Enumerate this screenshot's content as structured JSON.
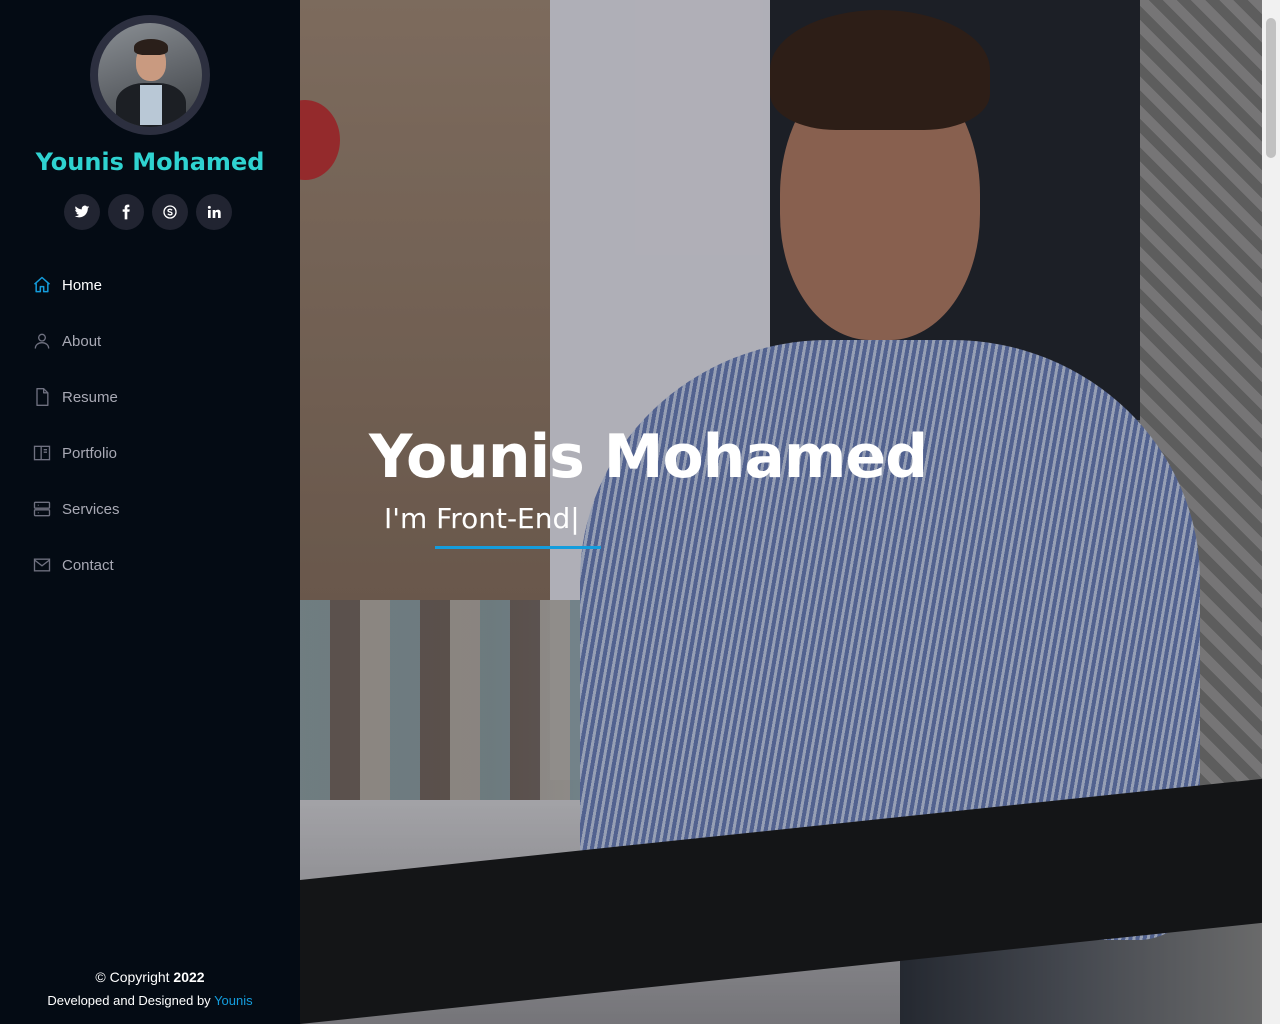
{
  "sidebar": {
    "name": "Younis Mohamed",
    "socials": [
      {
        "icon": "twitter-icon",
        "label": "twitter"
      },
      {
        "icon": "facebook-icon",
        "label": "facebook"
      },
      {
        "icon": "skype-icon",
        "label": "skype"
      },
      {
        "icon": "linkedin-icon",
        "label": "linkedin"
      }
    ],
    "nav": [
      {
        "label": "Home",
        "icon": "home-icon",
        "active": true
      },
      {
        "label": "About",
        "icon": "user-icon"
      },
      {
        "label": "Resume",
        "icon": "file-icon"
      },
      {
        "label": "Portfolio",
        "icon": "book-icon"
      },
      {
        "label": "Services",
        "icon": "server-icon"
      },
      {
        "label": "Contact",
        "icon": "envelope-icon"
      }
    ],
    "footer": {
      "copyright_prefix": "© Copyright",
      "year": "2022",
      "dev_prefix": "Developed and Designed by",
      "dev_link": "Younis"
    }
  },
  "hero": {
    "title": "Younis Mohamed",
    "subtitle": "I'm Front-End",
    "cursor": "|"
  },
  "colors": {
    "accent": "#149ddd",
    "name": "#2fd3d1",
    "sidebar_bg": "#040b14"
  }
}
